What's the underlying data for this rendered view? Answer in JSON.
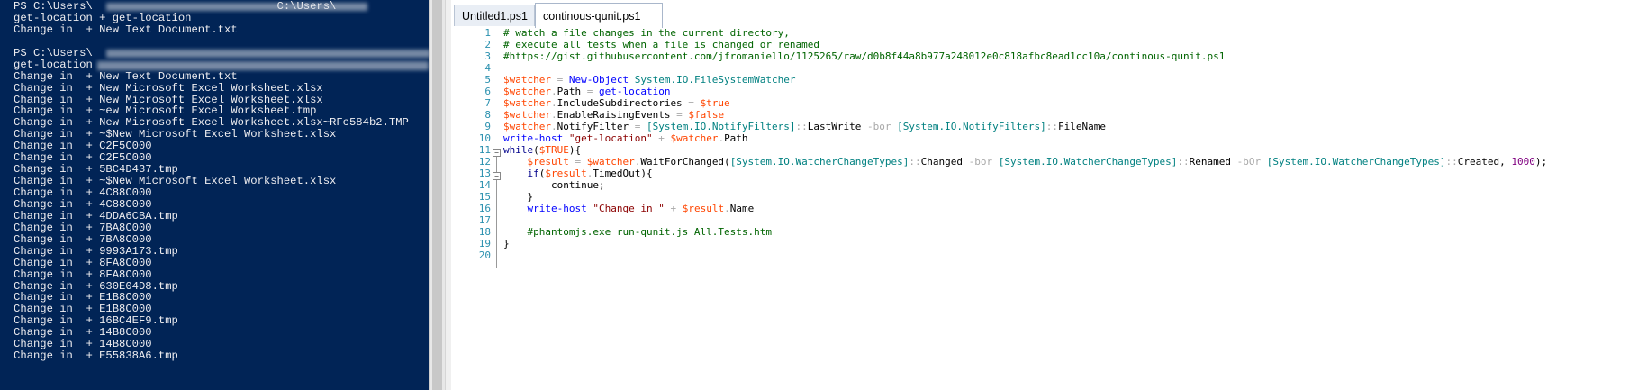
{
  "console": {
    "lines": [
      "PS C:\\Users\\                            C:\\Users\\",
      "get-location + get-location",
      "Change in  + New Text Document.txt",
      "",
      "PS C:\\Users\\",
      "get-location",
      "Change in  + New Text Document.txt",
      "Change in  + New Microsoft Excel Worksheet.xlsx",
      "Change in  + New Microsoft Excel Worksheet.xlsx",
      "Change in  + ~ew Microsoft Excel Worksheet.tmp",
      "Change in  + New Microsoft Excel Worksheet.xlsx~RFc584b2.TMP",
      "Change in  + ~$New Microsoft Excel Worksheet.xlsx",
      "Change in  + C2F5C000",
      "Change in  + C2F5C000",
      "Change in  + 5BC4D437.tmp",
      "Change in  + ~$New Microsoft Excel Worksheet.xlsx",
      "Change in  + 4C88C000",
      "Change in  + 4C88C000",
      "Change in  + 4DDA6CBA.tmp",
      "Change in  + 7BA8C000",
      "Change in  + 7BA8C000",
      "Change in  + 9993A173.tmp",
      "Change in  + 8FA8C000",
      "Change in  + 8FA8C000",
      "Change in  + 630E04D8.tmp",
      "Change in  + E1B8C000",
      "Change in  + E1B8C000",
      "Change in  + 16BC4EF9.tmp",
      "Change in  + 14B8C000",
      "Change in  + 14B8C000",
      "Change in  + E55838A6.tmp"
    ]
  },
  "tabs": [
    {
      "label": "Untitled1.ps1",
      "active": false
    },
    {
      "label": "continous-qunit.ps1",
      "active": true
    }
  ],
  "icons": {
    "tab_close": "close-icon",
    "fold_collapse": "minus-icon"
  },
  "colors": {
    "console_bg": "#012456",
    "console_fg": "#eeedf0",
    "comment": "#006400",
    "variable": "#ff4500",
    "command": "#0000ff",
    "type": "#008080",
    "operator": "#a9a9a9",
    "string": "#8b0000",
    "number": "#800080",
    "line_number": "#2b91af"
  },
  "editor": {
    "line_numbers": [
      "1",
      "2",
      "3",
      "4",
      "5",
      "6",
      "7",
      "8",
      "9",
      "10",
      "11",
      "12",
      "13",
      "14",
      "15",
      "16",
      "17",
      "18",
      "19",
      "20"
    ],
    "code": [
      [
        [
          "c-comment",
          "# watch a file changes in the current directory,"
        ]
      ],
      [
        [
          "c-comment",
          "# execute all tests when a file is changed or renamed"
        ]
      ],
      [
        [
          "c-comment",
          "#https://gist.githubusercontent.com/jfromaniello/1125265/raw/d0b8f44a8b977a248012e0c818afbc8ead1cc10a/continous-qunit.ps1"
        ]
      ],
      [],
      [
        [
          "c-var",
          "$watcher"
        ],
        [
          "c-op",
          " = "
        ],
        [
          "c-cmd",
          "New-Object"
        ],
        [
          "c-punct",
          " "
        ],
        [
          "c-type",
          "System.IO.FileSystemWatcher"
        ]
      ],
      [
        [
          "c-var",
          "$watcher"
        ],
        [
          "c-op",
          "."
        ],
        [
          "c-member",
          "Path"
        ],
        [
          "c-op",
          " = "
        ],
        [
          "c-cmd",
          "get-location"
        ]
      ],
      [
        [
          "c-var",
          "$watcher"
        ],
        [
          "c-op",
          "."
        ],
        [
          "c-member",
          "IncludeSubdirectories"
        ],
        [
          "c-op",
          " = "
        ],
        [
          "c-var",
          "$true"
        ]
      ],
      [
        [
          "c-var",
          "$watcher"
        ],
        [
          "c-op",
          "."
        ],
        [
          "c-member",
          "EnableRaisingEvents"
        ],
        [
          "c-op",
          " = "
        ],
        [
          "c-var",
          "$false"
        ]
      ],
      [
        [
          "c-var",
          "$watcher"
        ],
        [
          "c-op",
          "."
        ],
        [
          "c-member",
          "NotifyFilter"
        ],
        [
          "c-op",
          " = "
        ],
        [
          "c-type",
          "[System.IO.NotifyFilters]"
        ],
        [
          "c-op",
          "::"
        ],
        [
          "c-member",
          "LastWrite"
        ],
        [
          "c-op",
          " -bor "
        ],
        [
          "c-type",
          "[System.IO.NotifyFilters]"
        ],
        [
          "c-op",
          "::"
        ],
        [
          "c-member",
          "FileName"
        ]
      ],
      [
        [
          "c-cmd",
          "write-host"
        ],
        [
          "c-punct",
          " "
        ],
        [
          "c-str",
          "\"get-location\""
        ],
        [
          "c-op",
          " + "
        ],
        [
          "c-var",
          "$watcher"
        ],
        [
          "c-op",
          "."
        ],
        [
          "c-member",
          "Path"
        ]
      ],
      [
        [
          "c-kw",
          "while"
        ],
        [
          "c-punct",
          "("
        ],
        [
          "c-var",
          "$TRUE"
        ],
        [
          "c-punct",
          "){"
        ]
      ],
      [
        [
          "c-punct",
          "    "
        ],
        [
          "c-var",
          "$result"
        ],
        [
          "c-op",
          " = "
        ],
        [
          "c-var",
          "$watcher"
        ],
        [
          "c-op",
          "."
        ],
        [
          "c-member",
          "WaitForChanged"
        ],
        [
          "c-punct",
          "("
        ],
        [
          "c-type",
          "[System.IO.WatcherChangeTypes]"
        ],
        [
          "c-op",
          "::"
        ],
        [
          "c-member",
          "Changed"
        ],
        [
          "c-op",
          " -bor "
        ],
        [
          "c-type",
          "[System.IO.WatcherChangeTypes]"
        ],
        [
          "c-op",
          "::"
        ],
        [
          "c-member",
          "Renamed"
        ],
        [
          "c-op",
          " -bOr "
        ],
        [
          "c-type",
          "[System.IO.WatcherChangeTypes]"
        ],
        [
          "c-op",
          "::"
        ],
        [
          "c-member",
          "Created"
        ],
        [
          "c-punct",
          ", "
        ],
        [
          "c-num",
          "1000"
        ],
        [
          "c-punct",
          ");"
        ]
      ],
      [
        [
          "c-punct",
          "    "
        ],
        [
          "c-kw",
          "if"
        ],
        [
          "c-punct",
          "("
        ],
        [
          "c-var",
          "$result"
        ],
        [
          "c-op",
          "."
        ],
        [
          "c-member",
          "TimedOut"
        ],
        [
          "c-punct",
          "){"
        ]
      ],
      [
        [
          "c-punct",
          "        "
        ],
        [
          "c-member",
          "continue"
        ],
        [
          "c-punct",
          ";"
        ]
      ],
      [
        [
          "c-punct",
          "    }"
        ]
      ],
      [
        [
          "c-punct",
          "    "
        ],
        [
          "c-cmd",
          "write-host"
        ],
        [
          "c-punct",
          " "
        ],
        [
          "c-str",
          "\"Change in \""
        ],
        [
          "c-op",
          " + "
        ],
        [
          "c-var",
          "$result"
        ],
        [
          "c-op",
          "."
        ],
        [
          "c-member",
          "Name"
        ]
      ],
      [],
      [
        [
          "c-punct",
          "    "
        ],
        [
          "c-comment",
          "#phantomjs.exe run-qunit.js All.Tests.htm"
        ]
      ],
      [
        [
          "c-punct",
          "}"
        ]
      ],
      []
    ]
  }
}
